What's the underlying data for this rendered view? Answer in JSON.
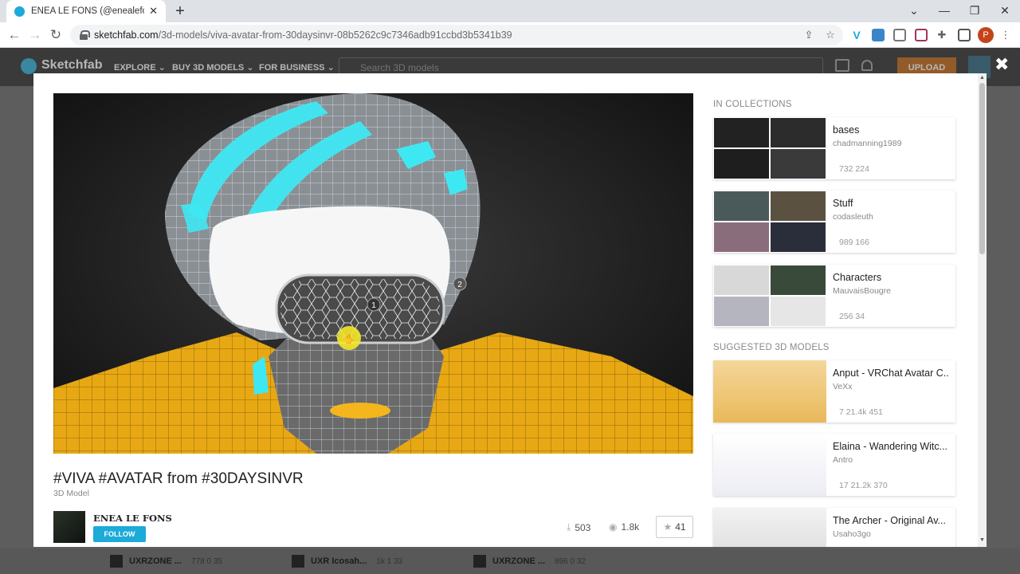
{
  "browser": {
    "tab_title": "ENEA LE FONS (@enealefons)",
    "tab_close": "✕",
    "new_tab": "+",
    "url_domain": "sketchfab.com",
    "url_path": "/3d-models/viva-avatar-from-30daysinvr-08b5262c9c7346adb91ccbd3b5341b39",
    "profile_initial": "P",
    "window_controls": [
      "⌄",
      "—",
      "❐",
      "✕"
    ]
  },
  "site": {
    "brand": "Sketchfab",
    "nav": [
      "EXPLORE ⌄",
      "BUY 3D MODELS ⌄",
      "FOR BUSINESS ⌄"
    ],
    "search_placeholder": "Search 3D models",
    "upload_label": "UPLOAD",
    "close_label": "✖"
  },
  "model": {
    "title": "#VIVA #AVATAR from #30DAYSINVR",
    "type": "3D Model",
    "author": "ENEA LE FONS",
    "follow_label": "FOLLOW",
    "downloads": "503",
    "views": "1.8k",
    "likes": "41",
    "annotation_1": "1",
    "annotation_2": "2"
  },
  "sidebar": {
    "collections_title": "IN COLLECTIONS",
    "collections": [
      {
        "name": "bases",
        "user": "chadmanning1989",
        "stats": "732   224"
      },
      {
        "name": "Stuff",
        "user": "codasleuth",
        "stats": "989   166"
      },
      {
        "name": "Characters",
        "user": "MauvaisBougre",
        "stats": "256   34"
      }
    ],
    "suggested_title": "SUGGESTED 3D MODELS",
    "suggested": [
      {
        "name": "Anput - VRChat Avatar C...",
        "user": "VeXx",
        "stats": "7   21.4k   451"
      },
      {
        "name": "Elaina - Wandering Witc...",
        "user": "Antro",
        "stats": "17   21.2k   370"
      },
      {
        "name": "The Archer - Original Av...",
        "user": "Usaho3go",
        "stats": ""
      }
    ]
  },
  "bottom_strip": [
    {
      "name": "UXRZONE ...",
      "stats": "778   0   35"
    },
    {
      "name": "UXR Icosah...",
      "stats": "1k   1   33"
    },
    {
      "name": "UXRZONE ...",
      "stats": "896   0   32"
    }
  ],
  "colors": {
    "accent": "#1caad9",
    "wire_cyan": "#3ee8f2",
    "wire_yellow": "#f5b51c",
    "upload_orange": "#c05a00"
  }
}
